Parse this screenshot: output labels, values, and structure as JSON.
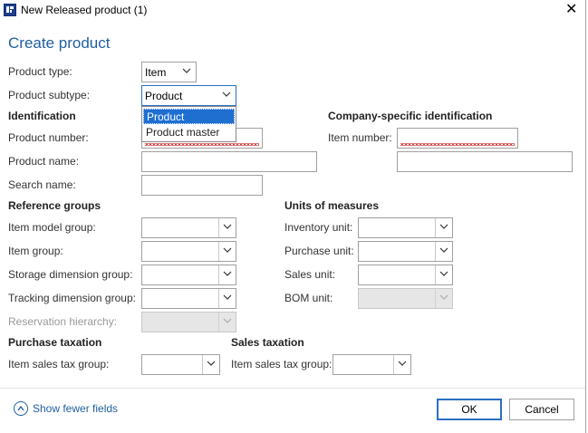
{
  "window": {
    "title": "New Released product (1)"
  },
  "page": {
    "heading": "Create product"
  },
  "product": {
    "type_label": "Product type:",
    "type_value": "Item",
    "subtype_label": "Product subtype:",
    "subtype_value": "Product",
    "subtype_options": [
      "Product",
      "Product master"
    ]
  },
  "identification": {
    "section": "Identification",
    "product_number_label": "Product number:",
    "product_name_label": "Product name:",
    "search_name_label": "Search name:"
  },
  "company_identification": {
    "section": "Company-specific identification",
    "item_number_label": "Item number:"
  },
  "reference_groups": {
    "section": "Reference groups",
    "item_model_group_label": "Item model group:",
    "item_group_label": "Item group:",
    "storage_dimension_group_label": "Storage dimension group:",
    "tracking_dimension_group_label": "Tracking dimension group:",
    "reservation_hierarchy_label": "Reservation hierarchy:"
  },
  "units": {
    "section": "Units of measures",
    "inventory_unit_label": "Inventory unit:",
    "purchase_unit_label": "Purchase unit:",
    "sales_unit_label": "Sales unit:",
    "bom_unit_label": "BOM unit:"
  },
  "purchase_taxation": {
    "section": "Purchase taxation",
    "item_sales_tax_group_label": "Item sales tax group:"
  },
  "sales_taxation": {
    "section": "Sales taxation",
    "item_sales_tax_group_label": "Item sales tax group:"
  },
  "footer": {
    "show_fewer_fields": "Show fewer fields",
    "ok_label": "OK",
    "cancel_label": "Cancel"
  },
  "colors": {
    "accent": "#215fa0",
    "selection": "#1e6fd0",
    "required_underline": "#d24646"
  },
  "icons": {
    "app": "app-window-icon",
    "close": "close-icon",
    "chevron": "chevron-down-icon",
    "show_fewer": "chevron-up-circle-icon"
  }
}
